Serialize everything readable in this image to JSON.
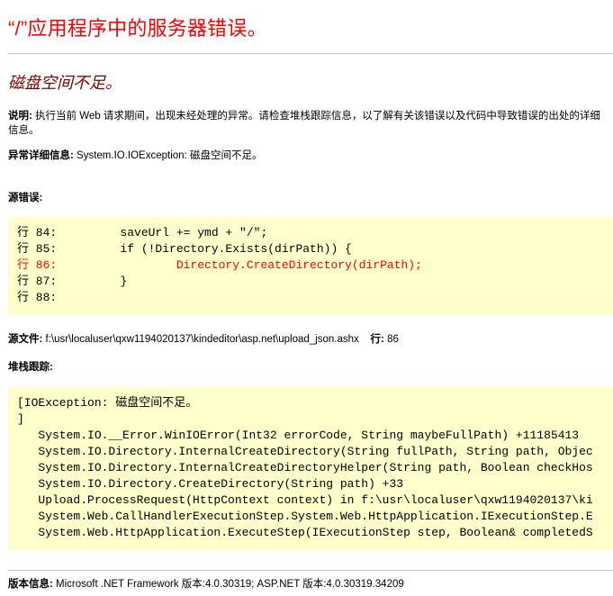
{
  "title": "“/”应用程序中的服务器错误。",
  "error_message": "磁盘空间不足。",
  "description": {
    "label": "说明:",
    "text": "执行当前 Web 请求期间，出现未经处理的异常。请检查堆栈跟踪信息，以了解有关该错误以及代码中导致错误的出处的详细信息。"
  },
  "exception_details": {
    "label": "异常详细信息:",
    "text": "System.IO.IOException: 磁盘空间不足。"
  },
  "source_error": {
    "heading": "源错误:",
    "lines": [
      "行 84:         saveUrl += ymd + \"/\";",
      "行 85:         if (!Directory.Exists(dirPath)) {",
      "行 86:                 Directory.CreateDirectory(dirPath);",
      "行 87:         }",
      "行 88:"
    ],
    "highlighted_line_index": 2
  },
  "source_file": {
    "label": "源文件:",
    "path": "f:\\usr\\localuser\\qxw1194020137\\kindeditor\\asp.net\\upload_json.ashx",
    "line_label": "行:",
    "line_number": "86"
  },
  "stack_trace": {
    "heading": "堆栈跟踪:",
    "lines": [
      "[IOException: 磁盘空间不足。",
      "]",
      "   System.IO.__Error.WinIOError(Int32 errorCode, String maybeFullPath) +11185413",
      "   System.IO.Directory.InternalCreateDirectory(String fullPath, String path, Objec",
      "   System.IO.Directory.InternalCreateDirectoryHelper(String path, Boolean checkHos",
      "   System.IO.Directory.CreateDirectory(String path) +33",
      "   Upload.ProcessRequest(HttpContext context) in f:\\usr\\localuser\\qxw1194020137\\ki",
      "   System.Web.CallHandlerExecutionStep.System.Web.HttpApplication.IExecutionStep.E",
      "   System.Web.HttpApplication.ExecuteStep(IExecutionStep step, Boolean& completedS"
    ]
  },
  "version_info": {
    "label": "版本信息:",
    "text": "Microsoft .NET Framework 版本:4.0.30319; ASP.NET 版本:4.0.30319.34209"
  },
  "colors": {
    "title": "#ff0000",
    "error_message": "#800000",
    "code_background": "#ffffcc",
    "highlight": "#ff0000",
    "rule": "#c0c0c0"
  }
}
